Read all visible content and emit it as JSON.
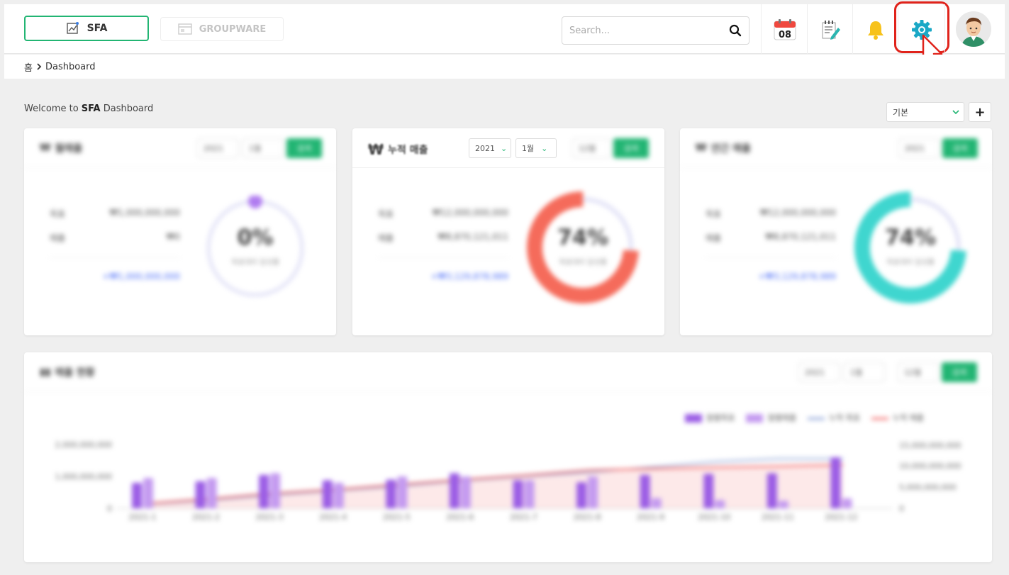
{
  "header": {
    "tab_sfa": "SFA",
    "tab_groupware": "GROUPWARE",
    "search_placeholder": "Search...",
    "calendar_day": "08"
  },
  "breadcrumb": {
    "home": "홈",
    "current": "Dashboard"
  },
  "welcome": {
    "prefix": "Welcome to ",
    "bold": "SFA",
    "suffix": " Dashboard"
  },
  "view_select": "기본",
  "cards": [
    {
      "title": "월매출",
      "year": "2021",
      "month": "1월",
      "go": "검색",
      "target_label": "목표",
      "target_value": "₩1,000,000,000",
      "actual_label": "매출",
      "actual_value": "₩0",
      "diff": "+₩1,000,000,000",
      "percent": "0%",
      "percent_sub": "목표대비 달성률",
      "color": "#b07cf0",
      "ratio": 0.0
    },
    {
      "title": "누적 매출",
      "year": "2021",
      "month_from": "1월",
      "month_to": "12월",
      "go": "검색",
      "target_label": "목표",
      "target_value": "₩12,000,000,000",
      "actual_label": "매출",
      "actual_value": "₩8,870,121,011",
      "diff": "+₩3,129,878,989",
      "percent": "74%",
      "percent_sub": "목표대비 달성률",
      "color": "#f56b5b",
      "ratio": 0.74
    },
    {
      "title": "연간 매출",
      "year": "2021",
      "go": "검색",
      "target_label": "목표",
      "target_value": "₩12,000,000,000",
      "actual_label": "매출",
      "actual_value": "₩8,870,121,011",
      "diff": "+₩3,129,878,989",
      "percent": "74%",
      "percent_sub": "목표대비 달성률",
      "color": "#3fd6cf",
      "ratio": 0.74
    }
  ],
  "chart_panel": {
    "title": "매출 현황",
    "year": "2021",
    "month_from": "1월",
    "month_to": "12월",
    "go": "검색",
    "legend": [
      "월별목표",
      "월별매출",
      "누적 목표",
      "누적 매출"
    ],
    "y_left_ticks": [
      "0",
      "1,000,000,000",
      "2,000,000,000"
    ],
    "y_right_ticks": [
      "0",
      "5,000,000,000",
      "10,000,000,000",
      "15,000,000,000"
    ]
  },
  "chart_data": {
    "type": "bar",
    "categories": [
      "2021-1",
      "2021-2",
      "2021-3",
      "2021-4",
      "2021-5",
      "2021-6",
      "2021-7",
      "2021-8",
      "2021-9",
      "2021-10",
      "2021-11",
      "2021-12"
    ],
    "series": [
      {
        "name": "월별목표",
        "values": [
          800000000,
          850000000,
          1050000000,
          880000000,
          900000000,
          1100000000,
          880000000,
          820000000,
          1050000000,
          1080000000,
          1100000000,
          1600000000
        ]
      },
      {
        "name": "월별매출",
        "values": [
          950000000,
          950000000,
          1100000000,
          800000000,
          1000000000,
          1000000000,
          880000000,
          1000000000,
          320000000,
          260000000,
          240000000,
          310000000
        ]
      },
      {
        "name": "누적 목표",
        "values": [
          800000000,
          1650000000,
          2700000000,
          3580000000,
          4480000000,
          5580000000,
          6460000000,
          7280000000,
          8330000000,
          9410000000,
          10510000000,
          12110000000
        ]
      },
      {
        "name": "누적 매출",
        "values": [
          950000000,
          1900000000,
          3000000000,
          3800000000,
          4800000000,
          5800000000,
          6680000000,
          7680000000,
          8000000000,
          8260000000,
          8500000000,
          8810000000
        ]
      }
    ],
    "ylim_left": [
      0,
      2000000000
    ],
    "ylim_right": [
      0,
      15000000000
    ],
    "colors": {
      "monthly_target": "#9b5de5",
      "monthly_sales": "#c49af0",
      "cum_target": "#8aa0d6",
      "cum_sales": "#f26a6a"
    }
  }
}
